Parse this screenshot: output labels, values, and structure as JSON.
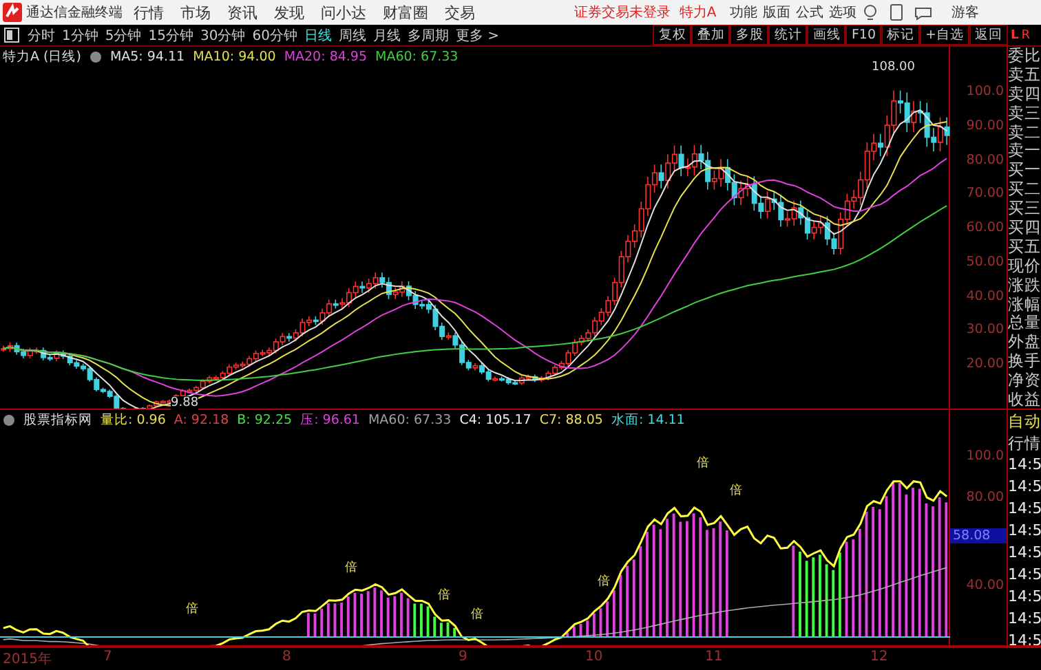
{
  "menubar": {
    "app_name": "通达信金融终端",
    "items": [
      "行情",
      "市场",
      "资讯",
      "发现",
      "问小达",
      "财富圈",
      "交易"
    ],
    "notice": "证券交易未登录  特力A",
    "right_items": [
      "功能",
      "版面",
      "公式",
      "选项"
    ],
    "user": "游客"
  },
  "toolbar": {
    "periods": [
      {
        "label": "分时",
        "selected": false
      },
      {
        "label": "1分钟",
        "selected": false
      },
      {
        "label": "5分钟",
        "selected": false
      },
      {
        "label": "15分钟",
        "selected": false
      },
      {
        "label": "30分钟",
        "selected": false
      },
      {
        "label": "60分钟",
        "selected": false
      },
      {
        "label": "日线",
        "selected": true
      },
      {
        "label": "周线",
        "selected": false
      },
      {
        "label": "月线",
        "selected": false
      },
      {
        "label": "多周期",
        "selected": false
      },
      {
        "label": "更多 >",
        "selected": false
      }
    ],
    "buttons": [
      "复权",
      "叠加",
      "多股",
      "统计",
      "画线",
      "F10",
      "标记",
      "+自选",
      "返回"
    ]
  },
  "price_pane": {
    "title": "特力A (日线)",
    "legend": [
      {
        "text": "MA5: 94.11",
        "color": "#e0e0e0"
      },
      {
        "text": "MA10: 94.00",
        "color": "#e8e050"
      },
      {
        "text": "MA20: 84.95",
        "color": "#e040e0"
      },
      {
        "text": "MA60: 67.33",
        "color": "#40d040"
      }
    ],
    "high_label": "108.00",
    "low_label": "9.88",
    "y_labels": [
      "100.0",
      "90.00",
      "80.00",
      "70.00",
      "60.00",
      "50.00",
      "40.00",
      "30.00",
      "20.00"
    ]
  },
  "indicator_pane": {
    "title": "股票指标网",
    "legend": [
      {
        "text": "量比: 0.96",
        "color": "#e8e050"
      },
      {
        "text": "A: 92.18",
        "color": "#e04040"
      },
      {
        "text": "B: 92.25",
        "color": "#40e040"
      },
      {
        "text": "压: 96.61",
        "color": "#e040e0"
      },
      {
        "text": "MA60: 67.33",
        "color": "#a0a0a0"
      },
      {
        "text": "C4: 105.17",
        "color": "#f0f0f0"
      },
      {
        "text": "C7: 88.05",
        "color": "#e8e050"
      },
      {
        "text": "水面: 14.11",
        "color": "#40e0e0"
      }
    ],
    "marks": [
      "倍",
      "倍",
      "倍",
      "倍",
      "倍",
      "倍",
      "倍"
    ],
    "y_labels": [
      "100.0",
      "80.00",
      "40.00"
    ],
    "current_label": "58.08"
  },
  "quote_panel": {
    "header": [
      "L",
      "R"
    ],
    "labels": [
      "委比",
      "卖五",
      "卖四",
      "卖三",
      "卖二",
      "卖一",
      "买一",
      "买二",
      "买三",
      "买四",
      "买五",
      "现价",
      "涨跌",
      "涨幅",
      "总量",
      "外盘",
      "换手",
      "净资",
      "收益"
    ],
    "mode": "自动",
    "tab": "行情",
    "times": [
      "14:5",
      "14:5",
      "14:5",
      "14:5",
      "14:5",
      "14:5",
      "14:5",
      "14:5",
      "14:5"
    ]
  },
  "date_axis": [
    "2015年",
    "7",
    "8",
    "9",
    "10",
    "11",
    "12"
  ]
}
